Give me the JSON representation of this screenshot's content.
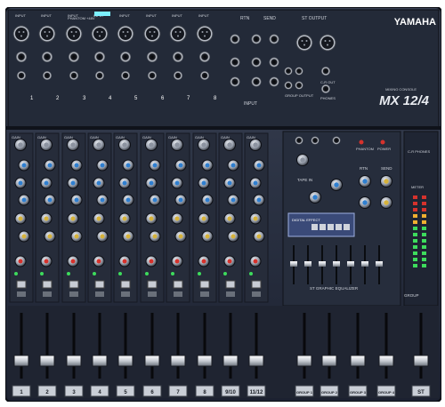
{
  "brand": {
    "name": "YAMAHA",
    "subtitle": "MIXING CONSOLE",
    "model": "MX 12/4"
  },
  "top_panel": {
    "phantom_label": "PHANTOM +48V",
    "input_labels": [
      "INPUT",
      "INPUT",
      "INPUT",
      "INPUT",
      "INPUT",
      "INPUT",
      "INPUT",
      "INPUT"
    ],
    "rtn_label": "RTN",
    "send_label": "SEND",
    "st_output_label": "ST OUTPUT",
    "group_output_label": "GROUP OUTPUT",
    "cr_out_label": "C-R OUT",
    "phones_label": "PHONES",
    "input_bottom_label": "INPUT",
    "channel_numbers": [
      "1",
      "2",
      "3",
      "4",
      "5",
      "6",
      "7",
      "8"
    ]
  },
  "channel_strip": {
    "labels": [
      "GAIN",
      "HIGH",
      "MID",
      "LOW",
      "AUX",
      "EFFECT",
      "PAN",
      "ON"
    ],
    "channel_labels": [
      "1",
      "2",
      "3",
      "4",
      "5",
      "6",
      "7",
      "8",
      "9/10",
      "11/12"
    ]
  },
  "master_section": {
    "tape_in_label": "TAPE IN",
    "rtn_label": "RTN",
    "send_label": "SEND",
    "phantom_label": "PHANTOM",
    "power_label": "POWER",
    "digital_effect_label": "DIGITAL EFFECT",
    "geq_label": "ST GRAPHIC EQUALIZER",
    "group_labels": [
      "GROUP 1",
      "GROUP 2",
      "GROUP 3",
      "GROUP 4"
    ],
    "st_label": "ST",
    "cr_phones_label": "C-R PHONES",
    "meter_label": "METER",
    "group_fader_label": "GROUP"
  },
  "colors": {
    "panel": "#2a3142",
    "panel_dark": "#141822",
    "accent_red": "#d6322c",
    "accent_blue": "#2f7fd0",
    "led_green": "#3ddc5c",
    "led_amber": "#f0b030",
    "knob_silver": "#c9ced6"
  }
}
